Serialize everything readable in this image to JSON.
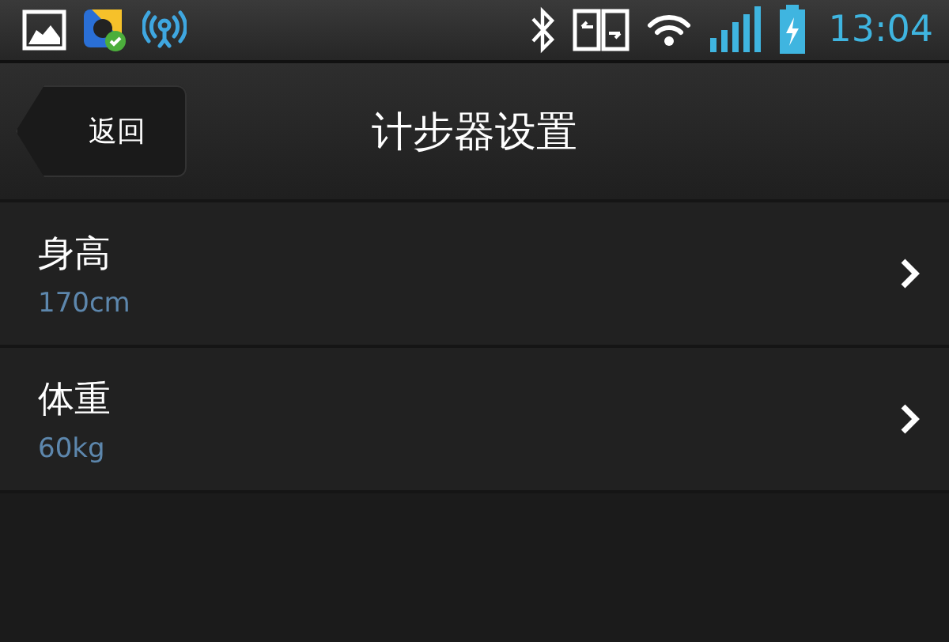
{
  "status_bar": {
    "time": "13:04"
  },
  "header": {
    "back_label": "返回",
    "title": "计步器设置"
  },
  "settings": [
    {
      "label": "身高",
      "value": "170cm"
    },
    {
      "label": "体重",
      "value": "60kg"
    }
  ]
}
